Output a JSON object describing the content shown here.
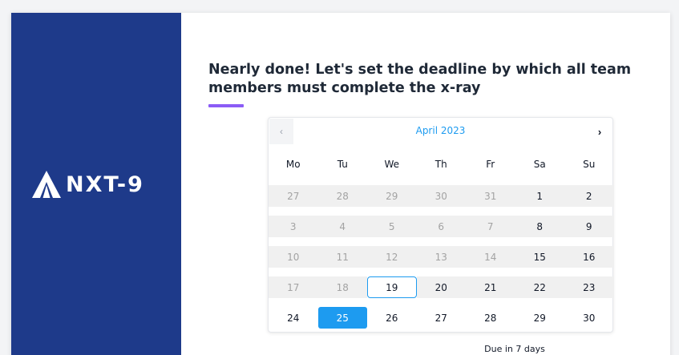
{
  "brand": {
    "name": "NXT-9",
    "sidebar_color": "#1e3a8a",
    "accent_purple": "#8b5cf6",
    "accent_blue": "#1d9bf0"
  },
  "heading": "Nearly done! Let's set the deadline by which all team members must complete the x-ray",
  "calendar": {
    "month_label": "April 2023",
    "prev_icon": "‹",
    "next_icon": "›",
    "weekdays": [
      "Mo",
      "Tu",
      "We",
      "Th",
      "Fr",
      "Sa",
      "Su"
    ],
    "weeks": [
      [
        {
          "d": "27",
          "muted": true
        },
        {
          "d": "28",
          "muted": true
        },
        {
          "d": "29",
          "muted": true
        },
        {
          "d": "30",
          "muted": true
        },
        {
          "d": "31",
          "muted": true
        },
        {
          "d": "1"
        },
        {
          "d": "2"
        }
      ],
      [
        {
          "d": "3",
          "muted": true
        },
        {
          "d": "4",
          "muted": true
        },
        {
          "d": "5",
          "muted": true
        },
        {
          "d": "6",
          "muted": true
        },
        {
          "d": "7",
          "muted": true
        },
        {
          "d": "8"
        },
        {
          "d": "9"
        }
      ],
      [
        {
          "d": "10",
          "muted": true
        },
        {
          "d": "11",
          "muted": true
        },
        {
          "d": "12",
          "muted": true
        },
        {
          "d": "13",
          "muted": true
        },
        {
          "d": "14",
          "muted": true
        },
        {
          "d": "15"
        },
        {
          "d": "16"
        }
      ],
      [
        {
          "d": "17",
          "muted": true
        },
        {
          "d": "18",
          "muted": true
        },
        {
          "d": "19",
          "today": true
        },
        {
          "d": "20"
        },
        {
          "d": "21"
        },
        {
          "d": "22"
        },
        {
          "d": "23"
        }
      ],
      [
        {
          "d": "24"
        },
        {
          "d": "25",
          "selected": true
        },
        {
          "d": "26"
        },
        {
          "d": "27"
        },
        {
          "d": "28"
        },
        {
          "d": "29"
        },
        {
          "d": "30"
        }
      ]
    ],
    "shaded_rows": [
      0,
      1,
      2,
      3
    ]
  },
  "due_text": "Due in 7 days"
}
